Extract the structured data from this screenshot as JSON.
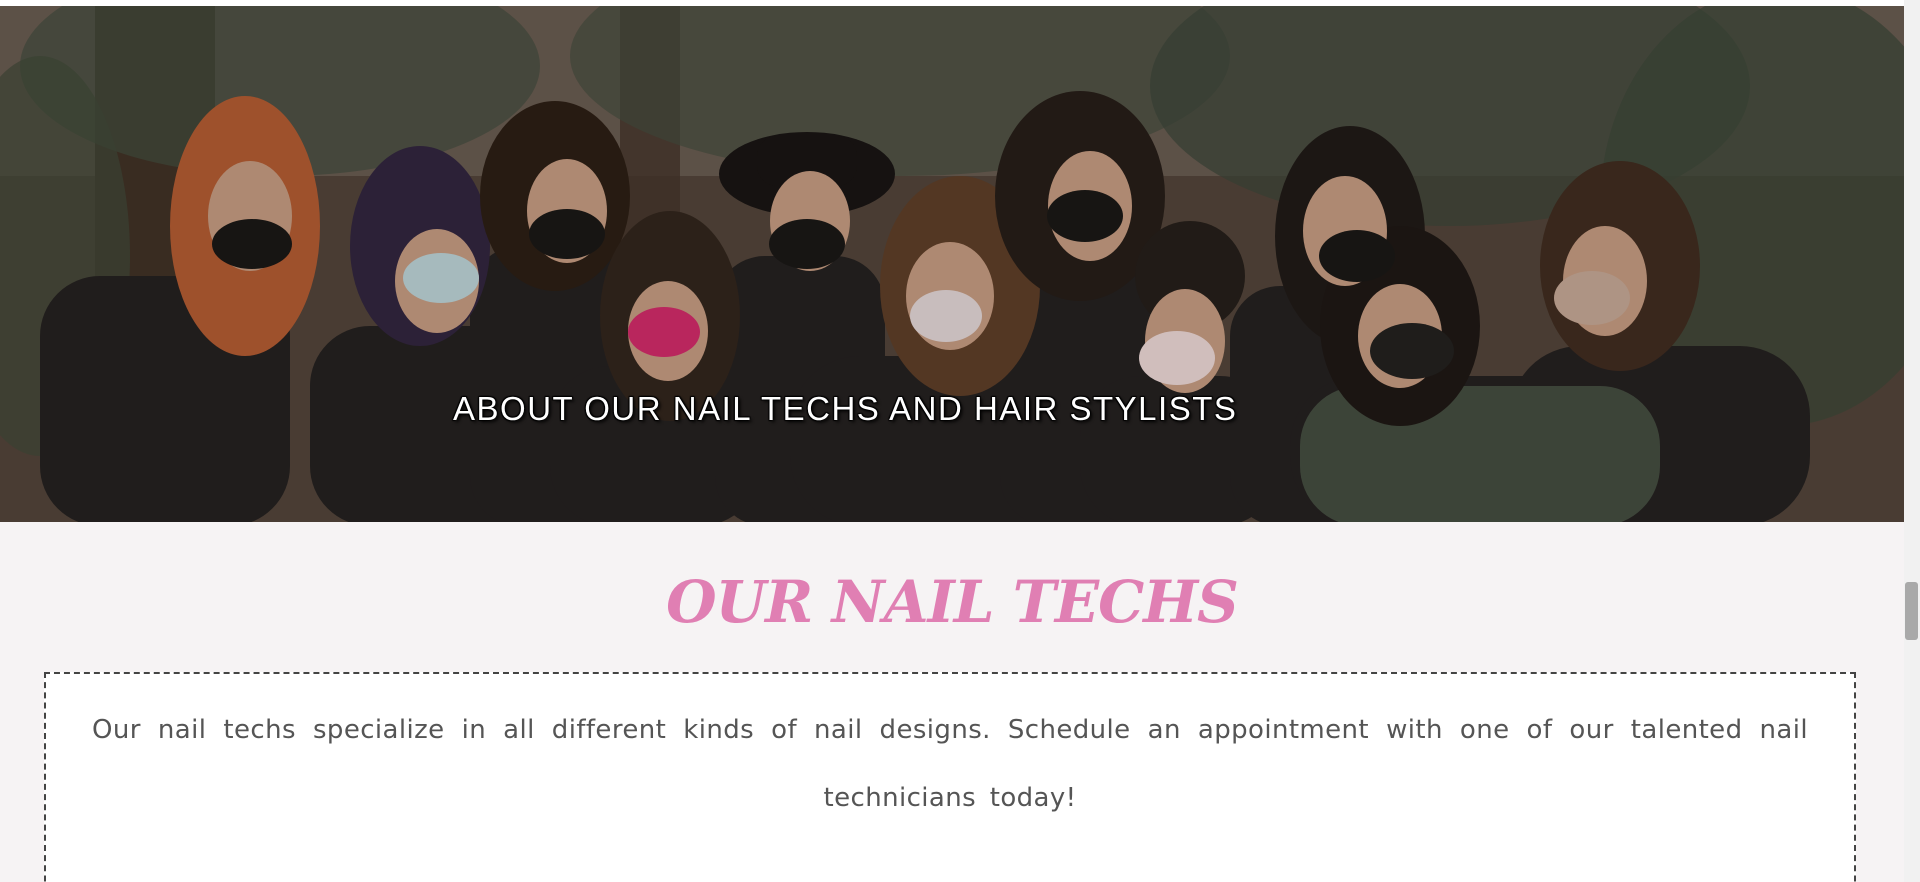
{
  "hero": {
    "title": "ABOUT OUR NAIL TECHS AND HAIR STYLISTS",
    "image_description_icon": "team-photo"
  },
  "section": {
    "title": "OUR NAIL TECHS",
    "body": "Our nail techs specialize in all different kinds of nail designs. Schedule an appointment with one of our talented nail technicians today!"
  },
  "colors": {
    "accent_pink": "#e07fb3",
    "page_bg": "#f6f3f4",
    "box_border": "#444444",
    "body_text": "#555555"
  }
}
